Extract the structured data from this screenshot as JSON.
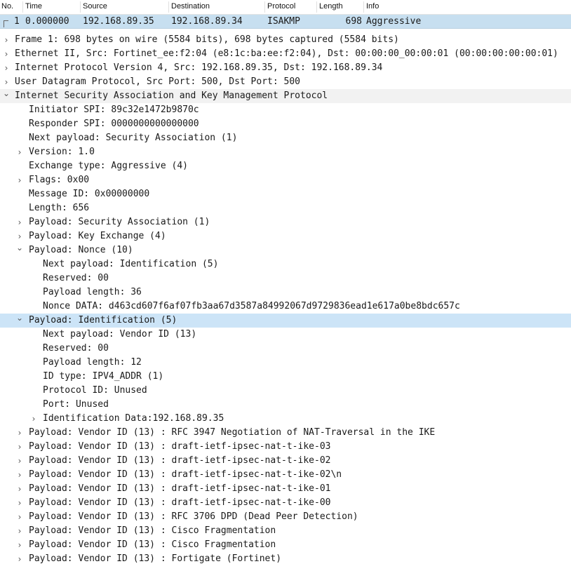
{
  "columns": [
    "No.",
    "Time",
    "Source",
    "Destination",
    "Protocol",
    "Length",
    "Info"
  ],
  "packet": {
    "no": "1",
    "time": "0.000000",
    "source": "192.168.89.35",
    "destination": "192.168.89.34",
    "protocol": "ISAKMP",
    "length": "698",
    "info": "Aggressive"
  },
  "tree": [
    {
      "text": "Frame 1: 698 bytes on wire (5584 bits), 698 bytes captured (5584 bits)",
      "level": 0,
      "state": "collapsed"
    },
    {
      "text": "Ethernet II, Src: Fortinet_ee:f2:04 (e8:1c:ba:ee:f2:04), Dst: 00:00:00_00:00:01 (00:00:00:00:00:01)",
      "level": 0,
      "state": "collapsed"
    },
    {
      "text": "Internet Protocol Version 4, Src: 192.168.89.35, Dst: 192.168.89.34",
      "level": 0,
      "state": "collapsed"
    },
    {
      "text": "User Datagram Protocol, Src Port: 500, Dst Port: 500",
      "level": 0,
      "state": "collapsed"
    },
    {
      "text": "Internet Security Association and Key Management Protocol",
      "level": 0,
      "state": "expanded",
      "section": true
    },
    {
      "text": "Initiator SPI: 89c32e1472b9870c",
      "level": 1,
      "state": "leaf"
    },
    {
      "text": "Responder SPI: 0000000000000000",
      "level": 1,
      "state": "leaf"
    },
    {
      "text": "Next payload: Security Association (1)",
      "level": 1,
      "state": "leaf"
    },
    {
      "text": "Version: 1.0",
      "level": 1,
      "state": "collapsed"
    },
    {
      "text": "Exchange type: Aggressive (4)",
      "level": 1,
      "state": "leaf"
    },
    {
      "text": "Flags: 0x00",
      "level": 1,
      "state": "collapsed"
    },
    {
      "text": "Message ID: 0x00000000",
      "level": 1,
      "state": "leaf"
    },
    {
      "text": "Length: 656",
      "level": 1,
      "state": "leaf"
    },
    {
      "text": "Payload: Security Association (1)",
      "level": 1,
      "state": "collapsed"
    },
    {
      "text": "Payload: Key Exchange (4)",
      "level": 1,
      "state": "collapsed"
    },
    {
      "text": "Payload: Nonce (10)",
      "level": 1,
      "state": "expanded"
    },
    {
      "text": "Next payload: Identification (5)",
      "level": 2,
      "state": "leaf"
    },
    {
      "text": "Reserved: 00",
      "level": 2,
      "state": "leaf"
    },
    {
      "text": "Payload length: 36",
      "level": 2,
      "state": "leaf"
    },
    {
      "text": "Nonce DATA: d463cd607f6af07fb3aa67d3587a84992067d9729836ead1e617a0be8bdc657c",
      "level": 2,
      "state": "leaf"
    },
    {
      "text": "Payload: Identification (5)",
      "level": 1,
      "state": "expanded",
      "selected": true
    },
    {
      "text": "Next payload: Vendor ID (13)",
      "level": 2,
      "state": "leaf"
    },
    {
      "text": "Reserved: 00",
      "level": 2,
      "state": "leaf"
    },
    {
      "text": "Payload length: 12",
      "level": 2,
      "state": "leaf"
    },
    {
      "text": "ID type: IPV4_ADDR (1)",
      "level": 2,
      "state": "leaf"
    },
    {
      "text": "Protocol ID: Unused",
      "level": 2,
      "state": "leaf"
    },
    {
      "text": "Port: Unused",
      "level": 2,
      "state": "leaf"
    },
    {
      "text": "Identification Data:192.168.89.35",
      "level": 2,
      "state": "collapsed"
    },
    {
      "text": "Payload: Vendor ID (13) : RFC 3947 Negotiation of NAT-Traversal in the IKE",
      "level": 1,
      "state": "collapsed"
    },
    {
      "text": "Payload: Vendor ID (13) : draft-ietf-ipsec-nat-t-ike-03",
      "level": 1,
      "state": "collapsed"
    },
    {
      "text": "Payload: Vendor ID (13) : draft-ietf-ipsec-nat-t-ike-02",
      "level": 1,
      "state": "collapsed"
    },
    {
      "text": "Payload: Vendor ID (13) : draft-ietf-ipsec-nat-t-ike-02\\n",
      "level": 1,
      "state": "collapsed"
    },
    {
      "text": "Payload: Vendor ID (13) : draft-ietf-ipsec-nat-t-ike-01",
      "level": 1,
      "state": "collapsed"
    },
    {
      "text": "Payload: Vendor ID (13) : draft-ietf-ipsec-nat-t-ike-00",
      "level": 1,
      "state": "collapsed"
    },
    {
      "text": "Payload: Vendor ID (13) : RFC 3706 DPD (Dead Peer Detection)",
      "level": 1,
      "state": "collapsed"
    },
    {
      "text": "Payload: Vendor ID (13) : Cisco Fragmentation",
      "level": 1,
      "state": "collapsed"
    },
    {
      "text": "Payload: Vendor ID (13) : Cisco Fragmentation",
      "level": 1,
      "state": "collapsed"
    },
    {
      "text": "Payload: Vendor ID (13) : Fortigate (Fortinet)",
      "level": 1,
      "state": "collapsed"
    }
  ],
  "icons": {
    "collapsed": "chevron-right-icon",
    "expanded": "chevron-down-icon"
  },
  "colors": {
    "selected_packet": "#c7dff0",
    "selected_tree": "#cce4f7",
    "section_band": "#f2f2f2"
  }
}
